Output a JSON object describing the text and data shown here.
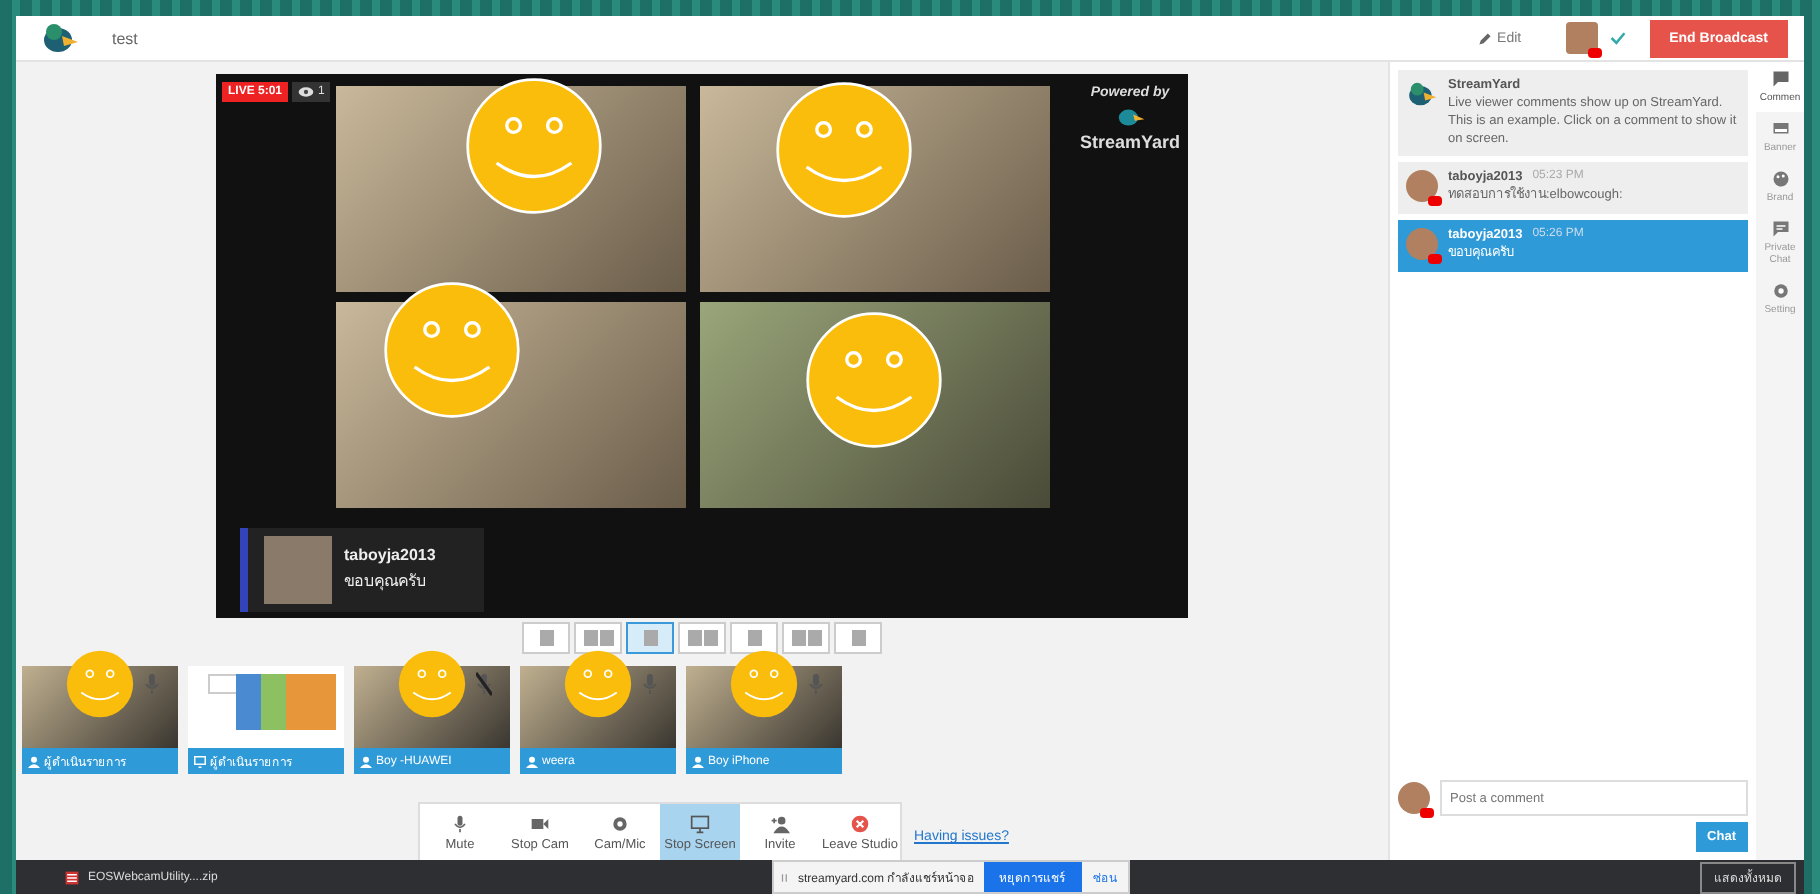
{
  "header": {
    "title": "test",
    "edit": "Edit",
    "end_button": "End Broadcast"
  },
  "stage": {
    "live_badge": "LIVE 5:01",
    "viewers": "1",
    "powered_by": "Powered by",
    "brand": "StreamYard"
  },
  "banner": {
    "name": "taboyja2013",
    "message": "ขอบคุณครับ"
  },
  "layouts": [
    {
      "selected": false
    },
    {
      "selected": false
    },
    {
      "selected": true
    },
    {
      "selected": false
    },
    {
      "selected": false
    },
    {
      "selected": false
    },
    {
      "selected": false
    }
  ],
  "participants": [
    {
      "name": "ผู้ดำเนินรายการ",
      "kind": "camera",
      "muted": false
    },
    {
      "name": "ผู้ดำเนินรายการ",
      "kind": "screen"
    },
    {
      "name": "Boy -HUAWEI",
      "kind": "camera",
      "muted": true
    },
    {
      "name": "weera",
      "kind": "camera",
      "muted": false
    },
    {
      "name": "Boy iPhone",
      "kind": "camera",
      "muted": false
    }
  ],
  "toolbar": [
    {
      "label": "Mute",
      "kind": "mic",
      "selected": false
    },
    {
      "label": "Stop Cam",
      "kind": "cam",
      "selected": false
    },
    {
      "label": "Cam/Mic",
      "kind": "gear",
      "selected": false
    },
    {
      "label": "Stop Screen",
      "kind": "screen",
      "selected": true
    },
    {
      "label": "Invite",
      "kind": "invite",
      "selected": false
    },
    {
      "label": "Leave Studio",
      "kind": "leave",
      "selected": false
    }
  ],
  "help_link": "Having issues?",
  "comments": [
    {
      "kind": "system",
      "author": "StreamYard",
      "text": "Live viewer comments show up on StreamYard. This is an example. Click on a comment to show it on screen.",
      "selected": false
    },
    {
      "kind": "youtube",
      "author": "taboyja2013",
      "time": "05:23 PM",
      "text": "ทดสอบการใช้งาน:elbowcough:",
      "selected": false
    },
    {
      "kind": "youtube",
      "author": "taboyja2013",
      "time": "05:26 PM",
      "text": "ขอบคุณครับ",
      "selected": true
    }
  ],
  "comment_input": {
    "placeholder": "Post a comment"
  },
  "chat_button": "Chat",
  "side_tabs": [
    {
      "label": "Commen",
      "kind": "comment",
      "selected": true
    },
    {
      "label": "Banner",
      "kind": "banner",
      "selected": false
    },
    {
      "label": "Brand",
      "kind": "brand",
      "selected": false
    },
    {
      "label": "Private Chat",
      "kind": "chat",
      "selected": false
    },
    {
      "label": "Setting",
      "kind": "gear",
      "selected": false
    }
  ],
  "share_bar": {
    "text": "streamyard.com กำลังแชร์หน้าจอ",
    "stop": "หยุดการแชร์",
    "hide": "ซ่อน"
  },
  "taskbar": {
    "download": "EOSWebcamUtility....zip",
    "show_all": "แสดงทั้งหมด"
  }
}
